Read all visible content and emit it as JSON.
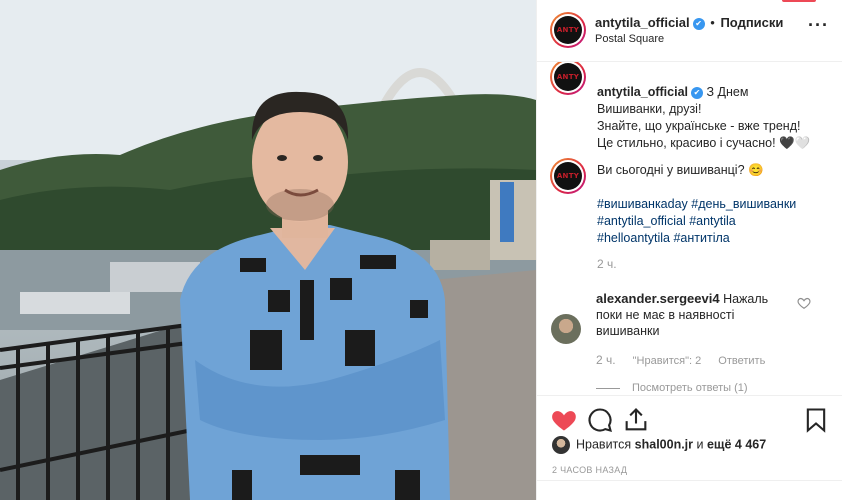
{
  "post": {
    "username": "antytila_official",
    "verified_mark": "✔",
    "separator": "•",
    "follow_label": "Подписки",
    "location": "Postal Square",
    "more_icon": "more-horizontal-icon",
    "avatar_text": "ANTY"
  },
  "caption": {
    "username": "antytila_official",
    "lines": [
      "З Днем",
      "Вишиванки, друзі!",
      "Знайте, що українське - вже тренд!",
      "Це стильно, красиво і сучасно! 🖤🤍"
    ],
    "second_comment": "Ви сьогодні у вишиванці? 😊",
    "hashtags": [
      "#вишиванкаday",
      "#день_вишиванки",
      "#antytila_official",
      "#antytila",
      "#helloantytila",
      "#антитіла"
    ],
    "time": "2 ч."
  },
  "comment": {
    "username": "alexander.sergeevi4",
    "text": "Нажаль поки не має в наявності вишиванки",
    "time": "2 ч.",
    "likes_label": "\"Нравится\": 2",
    "reply_label": "Ответить",
    "view_replies": "Посмотреть ответы (1)"
  },
  "actions": {
    "like_icon": "heart-filled-icon",
    "comment_icon": "comment-icon",
    "share_icon": "share-icon",
    "save_icon": "bookmark-icon",
    "like_color": "#ed4956"
  },
  "likes": {
    "prefix": "Нравится",
    "user": "shal00n.jr",
    "conj": "и",
    "others": "ещё 4 467"
  },
  "date": "2 ЧАСОВ НАЗАД"
}
